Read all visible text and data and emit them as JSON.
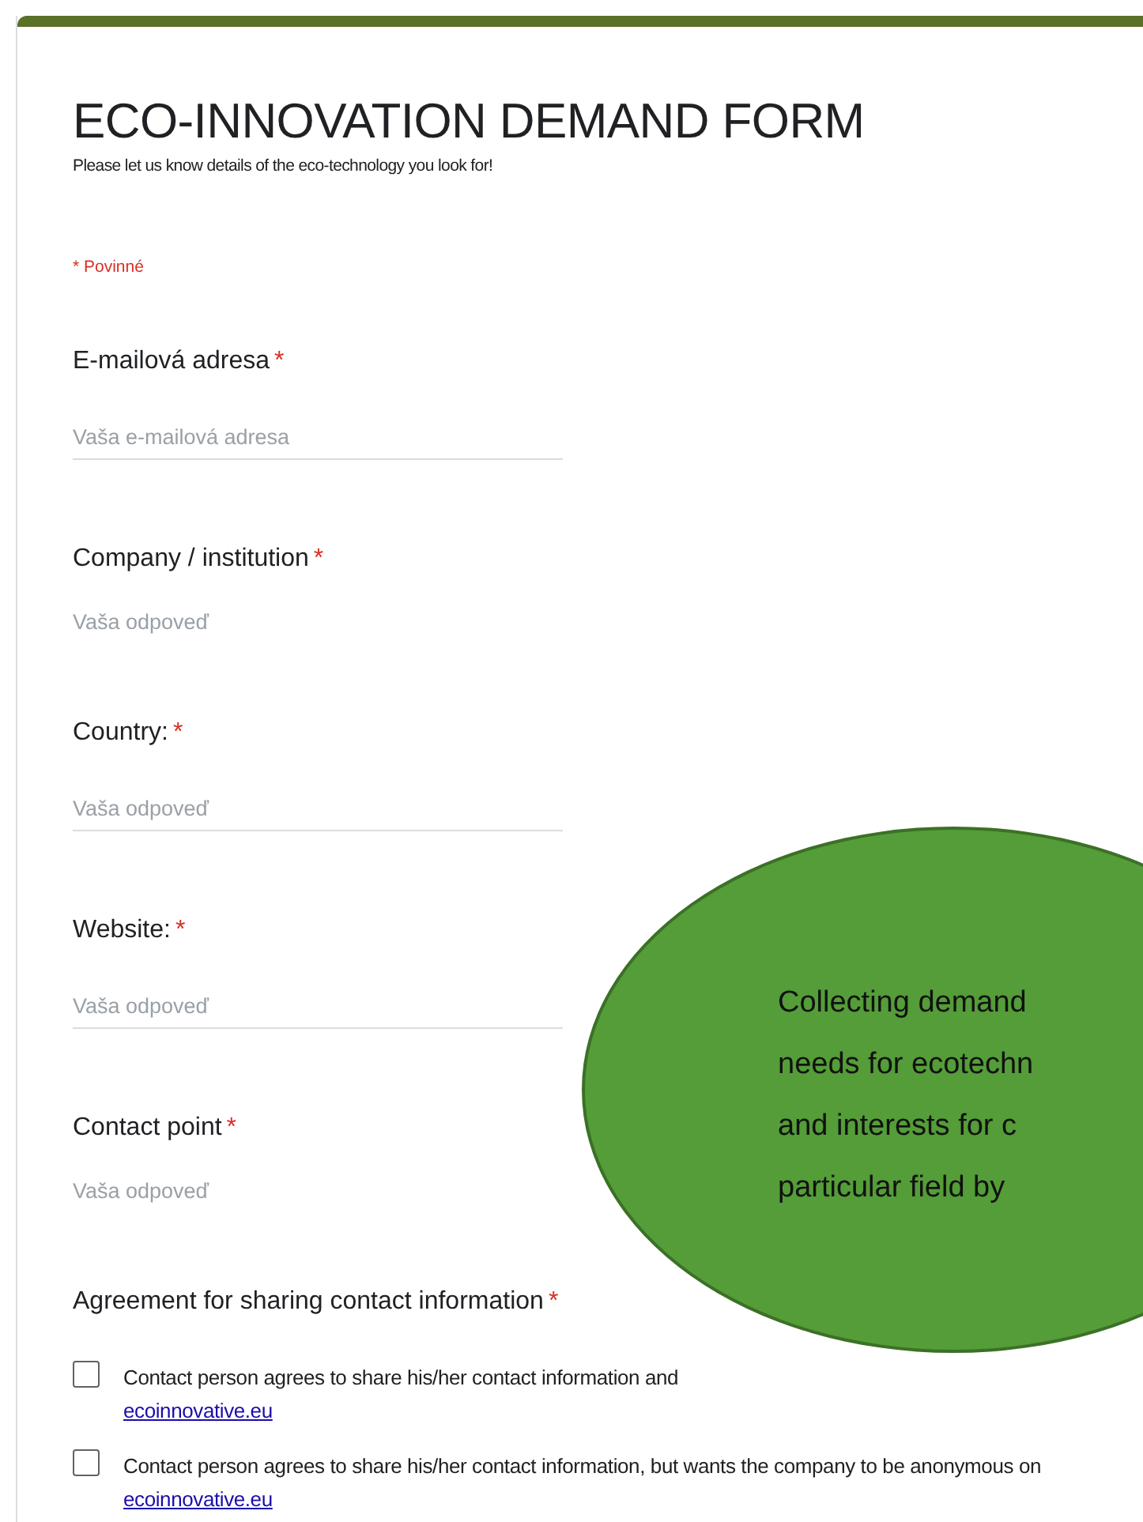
{
  "form": {
    "title": "ECO-INNOVATION DEMAND FORM",
    "description": "Please let us know details of the eco-technology you look for!",
    "required_note": "* Povinné"
  },
  "fields": [
    {
      "label": "E-mailová adresa",
      "required_mark": "*",
      "placeholder": "Vaša e-mailová adresa",
      "underline": true
    },
    {
      "label": "Company / institution",
      "required_mark": "*",
      "placeholder": "Vaša odpoveď",
      "underline": false
    },
    {
      "label": "Country:",
      "required_mark": "*",
      "placeholder": "Vaša odpoveď",
      "underline": true
    },
    {
      "label": "Website:",
      "required_mark": "*",
      "placeholder": "Vaša odpoveď",
      "underline": true
    },
    {
      "label": "Contact point",
      "required_mark": "*",
      "placeholder": "Vaša odpoveď",
      "underline": false
    }
  ],
  "agreement": {
    "label": "Agreement for sharing contact information",
    "required_mark": "*",
    "options": [
      {
        "text": "Contact person agrees to share his/her contact information and",
        "link": "ecoinnovative.eu",
        "checked": false
      },
      {
        "text": "Contact person agrees to share his/her contact information, but wants the company to be anonymous on",
        "link": "ecoinnovative.eu",
        "checked": false
      }
    ]
  },
  "callout": {
    "lines": [
      "Collecting demand",
      "needs for ecotechn",
      "and interests for c",
      "particular field by"
    ]
  }
}
